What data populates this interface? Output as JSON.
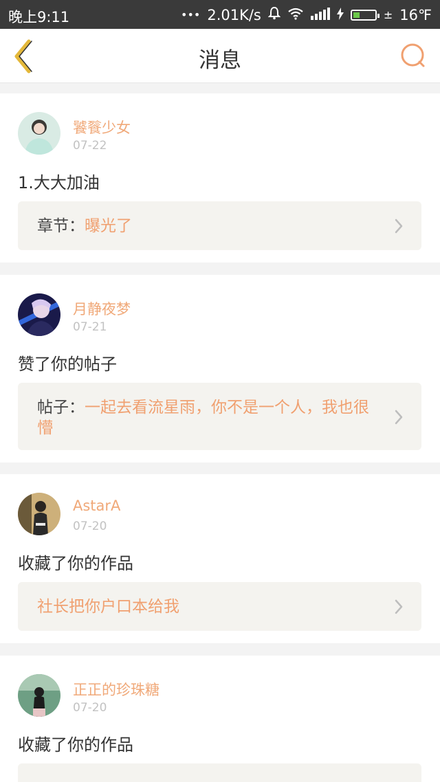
{
  "status_bar": {
    "time": "晚上9:11",
    "dots": "•••",
    "network_speed": "2.01K/s",
    "charging_sign": "±",
    "temperature": "16℉",
    "battery_level": 0.3
  },
  "header": {
    "title": "消息",
    "back_icon": "chevron-left-icon",
    "search_icon": "search-icon"
  },
  "colors": {
    "accent": "#f0a070",
    "back_icon": "#e4b83a",
    "name": "#f0a878",
    "date": "#c2c2c2",
    "ref_bg": "#f4f3ef"
  },
  "messages": [
    {
      "username": "饕餮少女",
      "date": "07-22",
      "content": "1.大大加油",
      "ref_label": "章节：",
      "ref_title": "曝光了"
    },
    {
      "username": "月静夜梦",
      "date": "07-21",
      "content": "赞了你的帖子",
      "ref_label": "帖子：",
      "ref_title": "一起去看流星雨，你不是一个人，我也很懵"
    },
    {
      "username": "AstarA",
      "date": "07-20",
      "content": "收藏了你的作品",
      "ref_label": "",
      "ref_title": "社长把你户口本给我"
    },
    {
      "username": "正正的珍珠糖",
      "date": "07-20",
      "content": "收藏了你的作品",
      "ref_label": "",
      "ref_title": ""
    }
  ]
}
